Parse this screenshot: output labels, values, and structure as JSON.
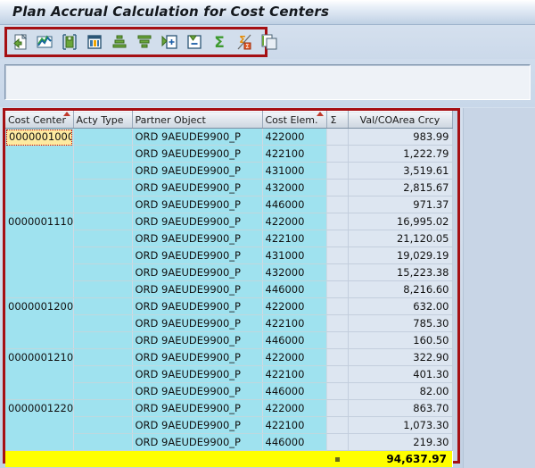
{
  "window": {
    "title": "Plan Accrual Calculation for Cost Centers"
  },
  "toolbar": {
    "items": [
      {
        "name": "detail-icon",
        "label": "Detail"
      },
      {
        "name": "graphic-icon",
        "label": "Graphic"
      },
      {
        "name": "save-layout-icon",
        "label": "Save Layout"
      },
      {
        "name": "choose-layout-icon",
        "label": "Choose Layout"
      },
      {
        "name": "sort-ascending-icon",
        "label": "Sort in Ascending Order"
      },
      {
        "name": "filter-icon",
        "label": "Set Filter"
      },
      {
        "name": "expand-hierarchy-icon",
        "label": "Expand"
      },
      {
        "name": "collapse-hierarchy-icon",
        "label": "Collapse"
      },
      {
        "name": "total-sum-icon",
        "label": "Total"
      },
      {
        "name": "delete-subtotal-icon",
        "label": "Delete Subtotal"
      },
      {
        "name": "copy-icon",
        "label": "Copy"
      }
    ]
  },
  "input_panel": {
    "value": "",
    "placeholder": ""
  },
  "grid": {
    "columns": [
      {
        "key": "cost_center",
        "label": "Cost Center",
        "sorted": true,
        "align": "left"
      },
      {
        "key": "acty_type",
        "label": "Acty Type",
        "sorted": false,
        "align": "left"
      },
      {
        "key": "partner_object",
        "label": "Partner Object",
        "sorted": false,
        "align": "left"
      },
      {
        "key": "cost_elem",
        "label": "Cost Elem.",
        "sorted": true,
        "align": "left"
      },
      {
        "key": "sigma",
        "label": "Σ",
        "sorted": false,
        "align": "left"
      },
      {
        "key": "val_coarea_crcy",
        "label": "Val/COArea Crcy",
        "sorted": false,
        "align": "right"
      }
    ],
    "selected_cell": {
      "row": 0,
      "column": "cost_center",
      "value": "0000001000"
    },
    "rows": [
      {
        "cost_center": "0000001000",
        "acty_type": "",
        "partner_object": "ORD 9AEUDE9900_P",
        "cost_elem": "422000",
        "sigma": "",
        "val_coarea_crcy": "983.99",
        "group_start": true
      },
      {
        "cost_center": "",
        "acty_type": "",
        "partner_object": "ORD 9AEUDE9900_P",
        "cost_elem": "422100",
        "sigma": "",
        "val_coarea_crcy": "1,222.79",
        "group_start": false
      },
      {
        "cost_center": "",
        "acty_type": "",
        "partner_object": "ORD 9AEUDE9900_P",
        "cost_elem": "431000",
        "sigma": "",
        "val_coarea_crcy": "3,519.61",
        "group_start": false
      },
      {
        "cost_center": "",
        "acty_type": "",
        "partner_object": "ORD 9AEUDE9900_P",
        "cost_elem": "432000",
        "sigma": "",
        "val_coarea_crcy": "2,815.67",
        "group_start": false
      },
      {
        "cost_center": "",
        "acty_type": "",
        "partner_object": "ORD 9AEUDE9900_P",
        "cost_elem": "446000",
        "sigma": "",
        "val_coarea_crcy": "971.37",
        "group_start": false
      },
      {
        "cost_center": "0000001110",
        "acty_type": "",
        "partner_object": "ORD 9AEUDE9900_P",
        "cost_elem": "422000",
        "sigma": "",
        "val_coarea_crcy": "16,995.02",
        "group_start": true
      },
      {
        "cost_center": "",
        "acty_type": "",
        "partner_object": "ORD 9AEUDE9900_P",
        "cost_elem": "422100",
        "sigma": "",
        "val_coarea_crcy": "21,120.05",
        "group_start": false
      },
      {
        "cost_center": "",
        "acty_type": "",
        "partner_object": "ORD 9AEUDE9900_P",
        "cost_elem": "431000",
        "sigma": "",
        "val_coarea_crcy": "19,029.19",
        "group_start": false
      },
      {
        "cost_center": "",
        "acty_type": "",
        "partner_object": "ORD 9AEUDE9900_P",
        "cost_elem": "432000",
        "sigma": "",
        "val_coarea_crcy": "15,223.38",
        "group_start": false
      },
      {
        "cost_center": "",
        "acty_type": "",
        "partner_object": "ORD 9AEUDE9900_P",
        "cost_elem": "446000",
        "sigma": "",
        "val_coarea_crcy": "8,216.60",
        "group_start": false
      },
      {
        "cost_center": "0000001200",
        "acty_type": "",
        "partner_object": "ORD 9AEUDE9900_P",
        "cost_elem": "422000",
        "sigma": "",
        "val_coarea_crcy": "632.00",
        "group_start": true
      },
      {
        "cost_center": "",
        "acty_type": "",
        "partner_object": "ORD 9AEUDE9900_P",
        "cost_elem": "422100",
        "sigma": "",
        "val_coarea_crcy": "785.30",
        "group_start": false
      },
      {
        "cost_center": "",
        "acty_type": "",
        "partner_object": "ORD 9AEUDE9900_P",
        "cost_elem": "446000",
        "sigma": "",
        "val_coarea_crcy": "160.50",
        "group_start": false
      },
      {
        "cost_center": "0000001210",
        "acty_type": "",
        "partner_object": "ORD 9AEUDE9900_P",
        "cost_elem": "422000",
        "sigma": "",
        "val_coarea_crcy": "322.90",
        "group_start": true
      },
      {
        "cost_center": "",
        "acty_type": "",
        "partner_object": "ORD 9AEUDE9900_P",
        "cost_elem": "422100",
        "sigma": "",
        "val_coarea_crcy": "401.30",
        "group_start": false
      },
      {
        "cost_center": "",
        "acty_type": "",
        "partner_object": "ORD 9AEUDE9900_P",
        "cost_elem": "446000",
        "sigma": "",
        "val_coarea_crcy": "82.00",
        "group_start": false
      },
      {
        "cost_center": "0000001220",
        "acty_type": "",
        "partner_object": "ORD 9AEUDE9900_P",
        "cost_elem": "422000",
        "sigma": "",
        "val_coarea_crcy": "863.70",
        "group_start": true
      },
      {
        "cost_center": "",
        "acty_type": "",
        "partner_object": "ORD 9AEUDE9900_P",
        "cost_elem": "422100",
        "sigma": "",
        "val_coarea_crcy": "1,073.30",
        "group_start": false
      },
      {
        "cost_center": "",
        "acty_type": "",
        "partner_object": "ORD 9AEUDE9900_P",
        "cost_elem": "446000",
        "sigma": "",
        "val_coarea_crcy": "219.30",
        "group_start": false
      }
    ],
    "total_row": {
      "cost_center": "",
      "acty_type": "",
      "partner_object": "",
      "cost_elem": "",
      "sigma_marker": true,
      "val_coarea_crcy": "94,637.97"
    }
  },
  "annotation": {
    "highlight_color": "#a50f13",
    "regions": [
      "toolbar",
      "grid"
    ]
  },
  "colors": {
    "key_cell": "#9fe2ef",
    "value_cell": "#dde6f1",
    "total_row": "#ffff00",
    "selection": "#fdeaa0",
    "annotation": "#a50f13"
  }
}
